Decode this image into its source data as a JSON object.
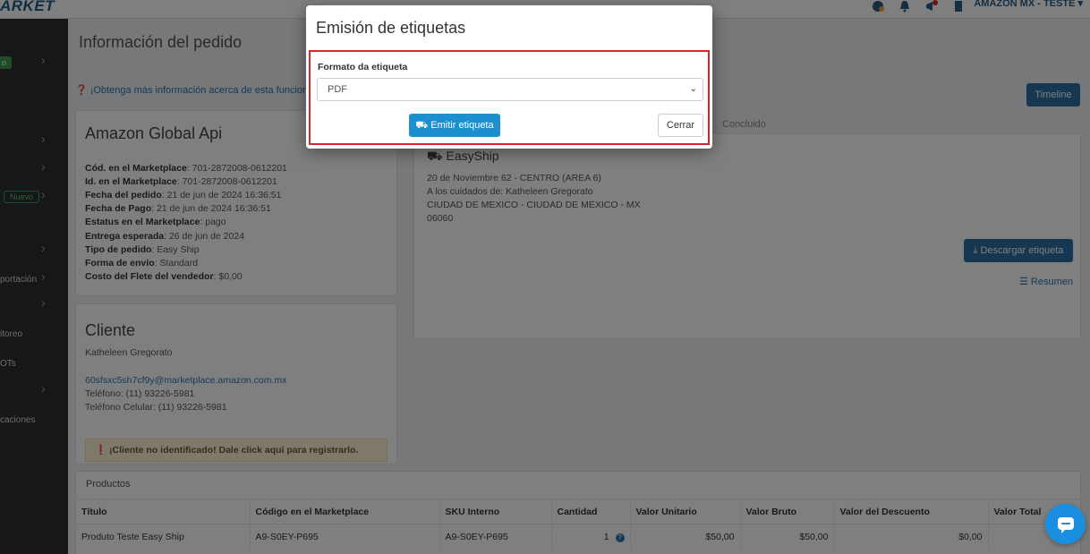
{
  "topbar": {
    "brand": "ARKET",
    "store_label": "AMAZON MX - TESTE ▾",
    "icons": [
      "extension-icon",
      "bell-icon",
      "megaphone-icon",
      "document-icon"
    ]
  },
  "sidebar": {
    "items": [
      {
        "label": "",
        "pill": "o"
      },
      {
        "label": ""
      },
      {
        "label": ""
      },
      {
        "label": "",
        "pill_outline": "Nuevo"
      },
      {
        "label": ""
      },
      {
        "label": "portación"
      },
      {
        "label": ""
      },
      {
        "label": "itoreo"
      },
      {
        "label": "OTs"
      },
      {
        "label": ""
      },
      {
        "label": "caciones"
      }
    ]
  },
  "page": {
    "title": "Información del pedido",
    "info_link": "¡Obtenga más información acerca de esta funcional",
    "timeline_button": "Timeline",
    "tab_concluido": "Concluido"
  },
  "order": {
    "title": "Amazon Global Api",
    "fields": [
      {
        "label": "Cód. en el Marketplace",
        "value": ": 701-2872008-0612201"
      },
      {
        "label": "Id. en el Marketplace",
        "value": ": 701-2872008-0612201"
      },
      {
        "label": "Fecha del pedido",
        "value": ": 21 de jun de 2024 16:36:51"
      },
      {
        "label": "Fecha de Pago",
        "value": ": 21 de jun de 2024 16:36:51"
      },
      {
        "label": "Estatus en el Marketplace",
        "value": ": pago"
      },
      {
        "label": "Entrega esperada",
        "value": ": 26 de jun de 2024"
      },
      {
        "label": "Tipo de pedido",
        "value": ": Easy Ship"
      },
      {
        "label": "Forma de envío",
        "value": ": Standard"
      },
      {
        "label": "Costo del Flete del vendedor",
        "value": ": $0,00"
      }
    ]
  },
  "shipping": {
    "title": "EasyShip",
    "address": [
      "20 de Noviembre 62 - CENTRO (AREA 6)",
      "A los cuidados de: Katheleen Gregorato",
      "CIUDAD DE MEXICO - CIUDAD DE MEXICO - MX",
      "06060"
    ],
    "download_button": "Descargar etiqueta",
    "resumen_link": "Resumen"
  },
  "client": {
    "title": "Cliente",
    "name": "Katheleen Gregorato",
    "email": "60sfsxc5sh7cf9y@marketplace.amazon.com.mx",
    "phone": "Teléfono: (11) 93226-5981",
    "cell": "Teléfono Celular: (11) 93226-5981",
    "warning": "¡Cliente no identificado! Dale click aquí para registrarlo."
  },
  "products": {
    "caption": "Productos",
    "columns": [
      "Título",
      "Código en el Marketplace",
      "SKU Interno",
      "Cantidad",
      "Valor Unitario",
      "Valor Bruto",
      "Valor del Descuento",
      "Valor Total"
    ],
    "rows": [
      [
        "Produto Teste Easy Ship",
        "A9-S0EY-P695",
        "A9-S0EY-P695",
        "1",
        "$50,00",
        "$50,00",
        "$0,00",
        ""
      ]
    ]
  },
  "modal": {
    "title": "Emisión de etiquetas",
    "field_label": "Formato da etiqueta",
    "select_value": "PDF",
    "emit_button": "Emitir etiqueta",
    "close_button": "Cerrar",
    "highlight_color": "#d9262b"
  }
}
